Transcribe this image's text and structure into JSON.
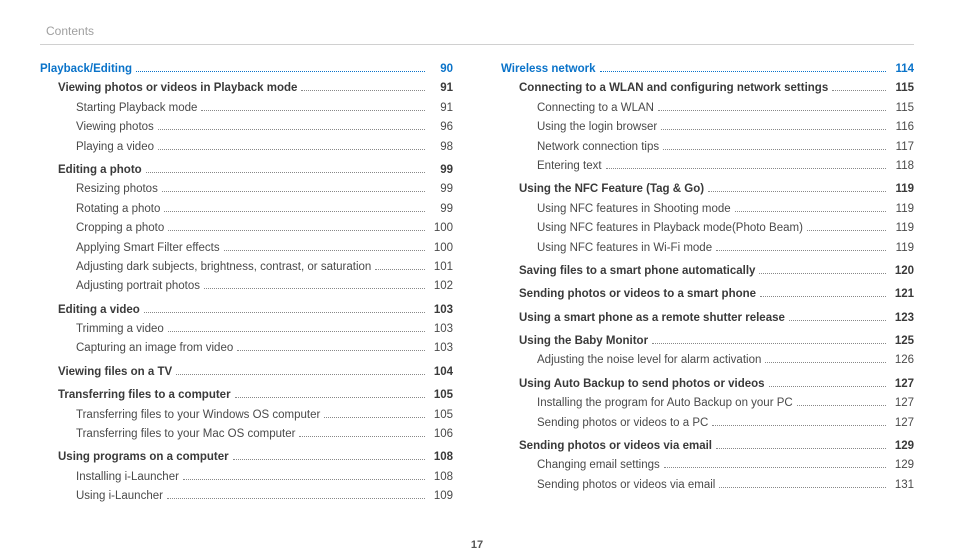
{
  "header_label": "Contents",
  "page_number": "17",
  "columns": [
    [
      {
        "label": "Playback/Editing",
        "page": "90",
        "level": 0,
        "section": true
      },
      {
        "label": "Viewing photos or videos in Playback mode",
        "page": "91",
        "level": 1,
        "bold": true
      },
      {
        "label": "Starting Playback mode",
        "page": "91",
        "level": 2
      },
      {
        "label": "Viewing photos",
        "page": "96",
        "level": 2
      },
      {
        "label": "Playing a video",
        "page": "98",
        "level": 2
      },
      {
        "gap": true
      },
      {
        "label": "Editing a photo",
        "page": "99",
        "level": 1,
        "bold": true
      },
      {
        "label": "Resizing photos",
        "page": "99",
        "level": 2
      },
      {
        "label": "Rotating a photo",
        "page": "99",
        "level": 2
      },
      {
        "label": "Cropping a photo",
        "page": "100",
        "level": 2
      },
      {
        "label": "Applying Smart Filter effects",
        "page": "100",
        "level": 2
      },
      {
        "label": "Adjusting dark subjects, brightness, contrast, or saturation",
        "page": "101",
        "level": 2
      },
      {
        "label": "Adjusting portrait photos",
        "page": "102",
        "level": 2
      },
      {
        "gap": true
      },
      {
        "label": "Editing a video",
        "page": "103",
        "level": 1,
        "bold": true
      },
      {
        "label": "Trimming a video",
        "page": "103",
        "level": 2
      },
      {
        "label": "Capturing an image from video",
        "page": "103",
        "level": 2
      },
      {
        "gap": true
      },
      {
        "label": "Viewing files on a TV",
        "page": "104",
        "level": 1,
        "bold": true
      },
      {
        "gap": true
      },
      {
        "label": "Transferring files to a computer",
        "page": "105",
        "level": 1,
        "bold": true
      },
      {
        "label": "Transferring files to your Windows OS computer",
        "page": "105",
        "level": 2
      },
      {
        "label": "Transferring files to your Mac OS computer",
        "page": "106",
        "level": 2
      },
      {
        "gap": true
      },
      {
        "label": "Using programs on a computer",
        "page": "108",
        "level": 1,
        "bold": true
      },
      {
        "label": "Installing i-Launcher",
        "page": "108",
        "level": 2
      },
      {
        "label": "Using i-Launcher",
        "page": "109",
        "level": 2
      }
    ],
    [
      {
        "label": "Wireless network",
        "page": "114",
        "level": 0,
        "section": true
      },
      {
        "label": "Connecting to a WLAN and configuring network settings",
        "page": "115",
        "level": 1,
        "bold": true
      },
      {
        "label": "Connecting to a WLAN",
        "page": "115",
        "level": 2
      },
      {
        "label": "Using the login browser",
        "page": "116",
        "level": 2
      },
      {
        "label": "Network connection tips",
        "page": "117",
        "level": 2
      },
      {
        "label": "Entering text",
        "page": "118",
        "level": 2
      },
      {
        "gap": true
      },
      {
        "label": "Using the NFC Feature (Tag & Go)",
        "page": "119",
        "level": 1,
        "bold": true
      },
      {
        "label": "Using NFC features in Shooting mode",
        "page": "119",
        "level": 2
      },
      {
        "label": "Using NFC features in Playback mode(Photo Beam)",
        "page": "119",
        "level": 2
      },
      {
        "label": "Using NFC features in Wi-Fi mode",
        "page": "119",
        "level": 2
      },
      {
        "gap": true
      },
      {
        "label": "Saving files to a smart phone automatically",
        "page": "120",
        "level": 1,
        "bold": true
      },
      {
        "gap": true
      },
      {
        "label": "Sending photos or videos to a smart phone",
        "page": "121",
        "level": 1,
        "bold": true
      },
      {
        "gap": true
      },
      {
        "label": "Using a smart phone as a remote shutter release",
        "page": "123",
        "level": 1,
        "bold": true
      },
      {
        "gap": true
      },
      {
        "label": "Using the Baby Monitor",
        "page": "125",
        "level": 1,
        "bold": true
      },
      {
        "label": "Adjusting the noise level for alarm activation",
        "page": "126",
        "level": 2
      },
      {
        "gap": true
      },
      {
        "label": "Using Auto Backup to send photos or videos",
        "page": "127",
        "level": 1,
        "bold": true
      },
      {
        "label": "Installing the program for Auto Backup on your PC",
        "page": "127",
        "level": 2
      },
      {
        "label": "Sending photos or videos to a PC",
        "page": "127",
        "level": 2
      },
      {
        "gap": true
      },
      {
        "label": "Sending photos or videos via email",
        "page": "129",
        "level": 1,
        "bold": true
      },
      {
        "label": "Changing email settings",
        "page": "129",
        "level": 2
      },
      {
        "label": "Sending photos or videos via email",
        "page": "131",
        "level": 2
      }
    ]
  ]
}
